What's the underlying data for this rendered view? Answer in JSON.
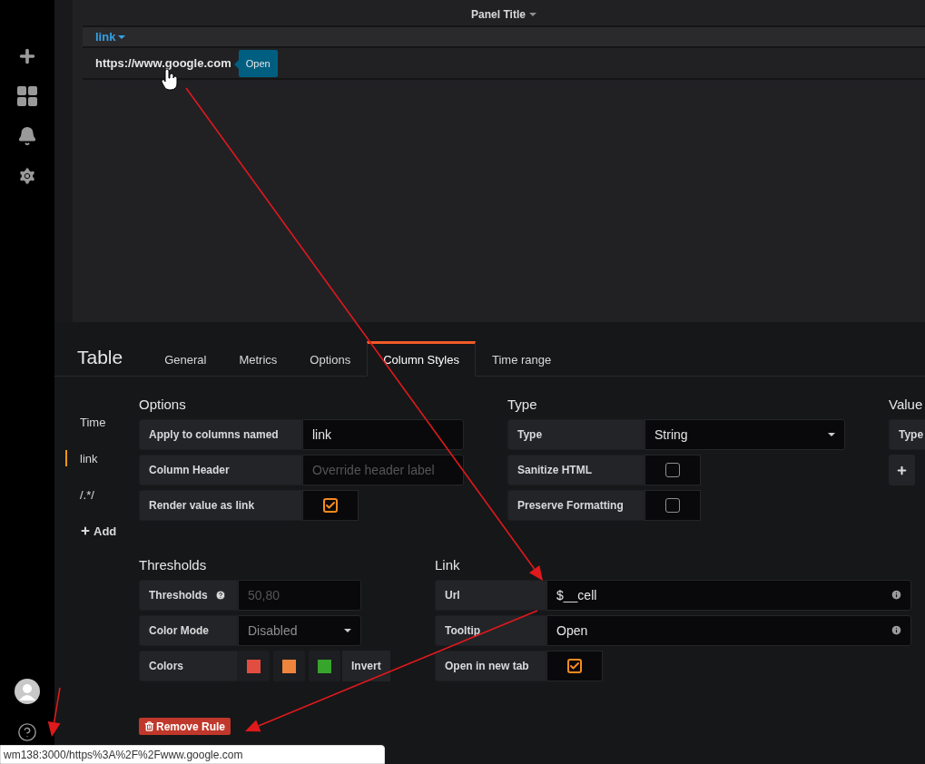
{
  "panel": {
    "title": "Panel Title",
    "table": {
      "columns": [
        "link"
      ],
      "rows": [
        [
          "https://www.google.com"
        ]
      ]
    },
    "tooltip": "Open"
  },
  "editor": {
    "title": "Table",
    "tabs": [
      {
        "label": "General",
        "selected": false
      },
      {
        "label": "Metrics",
        "selected": false
      },
      {
        "label": "Options",
        "selected": false
      },
      {
        "label": "Column Styles",
        "selected": true
      },
      {
        "label": "Time range",
        "selected": false
      }
    ],
    "column_rules": [
      {
        "label": "Time",
        "selected": false
      },
      {
        "label": "link",
        "selected": true
      },
      {
        "label": "/.*/",
        "selected": false
      }
    ],
    "add_label": "Add",
    "options": {
      "heading": "Options",
      "rows": [
        {
          "kind": "text",
          "label": "Apply to columns named",
          "value": "link"
        },
        {
          "kind": "text",
          "label": "Column Header",
          "placeholder": "Override header label"
        },
        {
          "kind": "checkbox",
          "label": "Render value as link",
          "checked": true
        }
      ]
    },
    "type": {
      "heading": "Type",
      "rows": [
        {
          "kind": "select",
          "label": "Type",
          "value": "String"
        },
        {
          "kind": "checkbox",
          "label": "Sanitize HTML",
          "checked": false
        },
        {
          "kind": "checkbox",
          "label": "Preserve Formatting",
          "checked": false
        }
      ]
    },
    "value": {
      "heading": "Value",
      "rows": [
        {
          "kind": "label",
          "label": "Type"
        }
      ]
    },
    "thresholds": {
      "heading": "Thresholds",
      "rows": [
        {
          "kind": "text",
          "label": "Thresholds",
          "help": true,
          "placeholder": "50,80"
        },
        {
          "kind": "select",
          "label": "Color Mode",
          "value": "Disabled",
          "muted": true
        },
        {
          "kind": "colors",
          "label": "Colors",
          "colors": [
            {
              "color": "#e24d42"
            },
            {
              "color": "#ef843c"
            },
            {
              "color": "#37a42c"
            }
          ],
          "invert": "Invert"
        }
      ]
    },
    "link": {
      "heading": "Link",
      "rows": [
        {
          "kind": "text",
          "label": "Url",
          "value": "$__cell",
          "info": true
        },
        {
          "kind": "text",
          "label": "Tooltip",
          "value": "Open",
          "info": true
        },
        {
          "kind": "checkbox",
          "label": "Open in new tab",
          "checked": true
        }
      ]
    },
    "remove_rule": "Remove Rule"
  },
  "status_bar": {
    "url": "wm138:3000/https%3A%2F%2Fwww.google.com"
  }
}
